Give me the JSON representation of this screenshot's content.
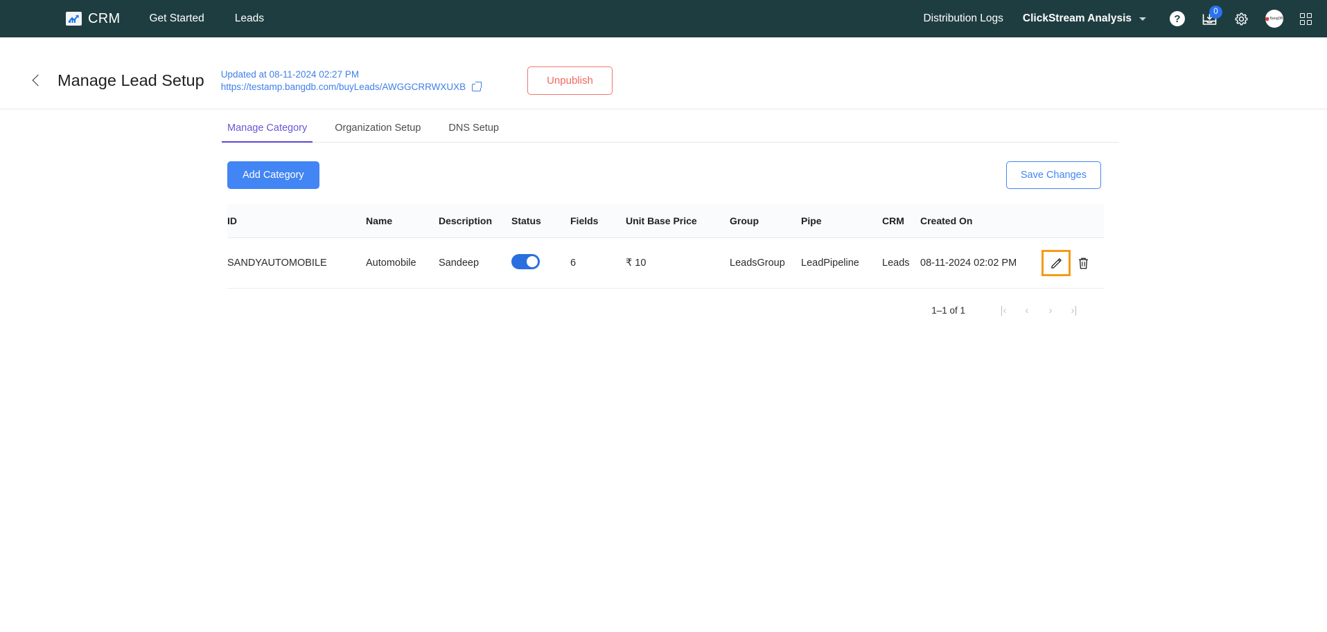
{
  "navbar": {
    "brand": {
      "logo_icon": "chart-arrow-icon",
      "name": "CRM"
    },
    "links": [
      {
        "label": "Get Started"
      },
      {
        "label": "Leads"
      }
    ],
    "right_links": [
      {
        "label": "Distribution Logs"
      }
    ],
    "dropdown": {
      "label": "ClickStream Analysis",
      "icon": "chevron-down-icon"
    },
    "icons": [
      {
        "name": "help-icon",
        "glyph": "?"
      },
      {
        "name": "inbox-download-icon",
        "badge": "0"
      },
      {
        "name": "gear-icon"
      },
      {
        "name": "avatar",
        "label": "BangDB"
      },
      {
        "name": "apps-grid-icon"
      }
    ],
    "background": "#1e3d40"
  },
  "header": {
    "back_icon": "back-chevron-icon",
    "title": "Manage Lead Setup",
    "updated_text": "Updated at 08-11-2024 02:27 PM",
    "url": "https://testamp.bangdb.com/buyLeads/AWGGCRRWXUXB",
    "external_link_icon": "external-link-icon",
    "unpublish_label": "Unpublish",
    "unpublish_color": "#f2675c",
    "link_color": "#3f7fe8"
  },
  "tabs": [
    {
      "label": "Manage Category",
      "active": true
    },
    {
      "label": "Organization Setup",
      "active": false
    },
    {
      "label": "DNS Setup",
      "active": false
    }
  ],
  "toolbar": {
    "add_label": "Add Category",
    "add_color": "#4285f4",
    "save_label": "Save Changes",
    "save_color": "#4285f4"
  },
  "table": {
    "columns": [
      "ID",
      "Name",
      "Description",
      "Status",
      "Fields",
      "Unit Base Price",
      "Group",
      "Pipe",
      "CRM",
      "Created On"
    ],
    "rows": [
      {
        "id": "SANDYAUTOMOBILE",
        "name": "Automobile",
        "description": "Sandeep",
        "status": "on",
        "fields": "6",
        "unit_base_price": "₹ 10",
        "group": "LeadsGroup",
        "pipe": "LeadPipeline",
        "crm": "Leads",
        "created_on": "08-11-2024 02:02 PM",
        "edit_icon": "pencil-edit-icon",
        "delete_icon": "trash-delete-icon"
      }
    ]
  },
  "pagination": {
    "range_text": "1–1 of 1",
    "first_label": "|‹",
    "prev_label": "‹",
    "next_label": "›",
    "last_label": "›|"
  },
  "highlight": {
    "color": "#f59b17",
    "target": "edit-button"
  }
}
